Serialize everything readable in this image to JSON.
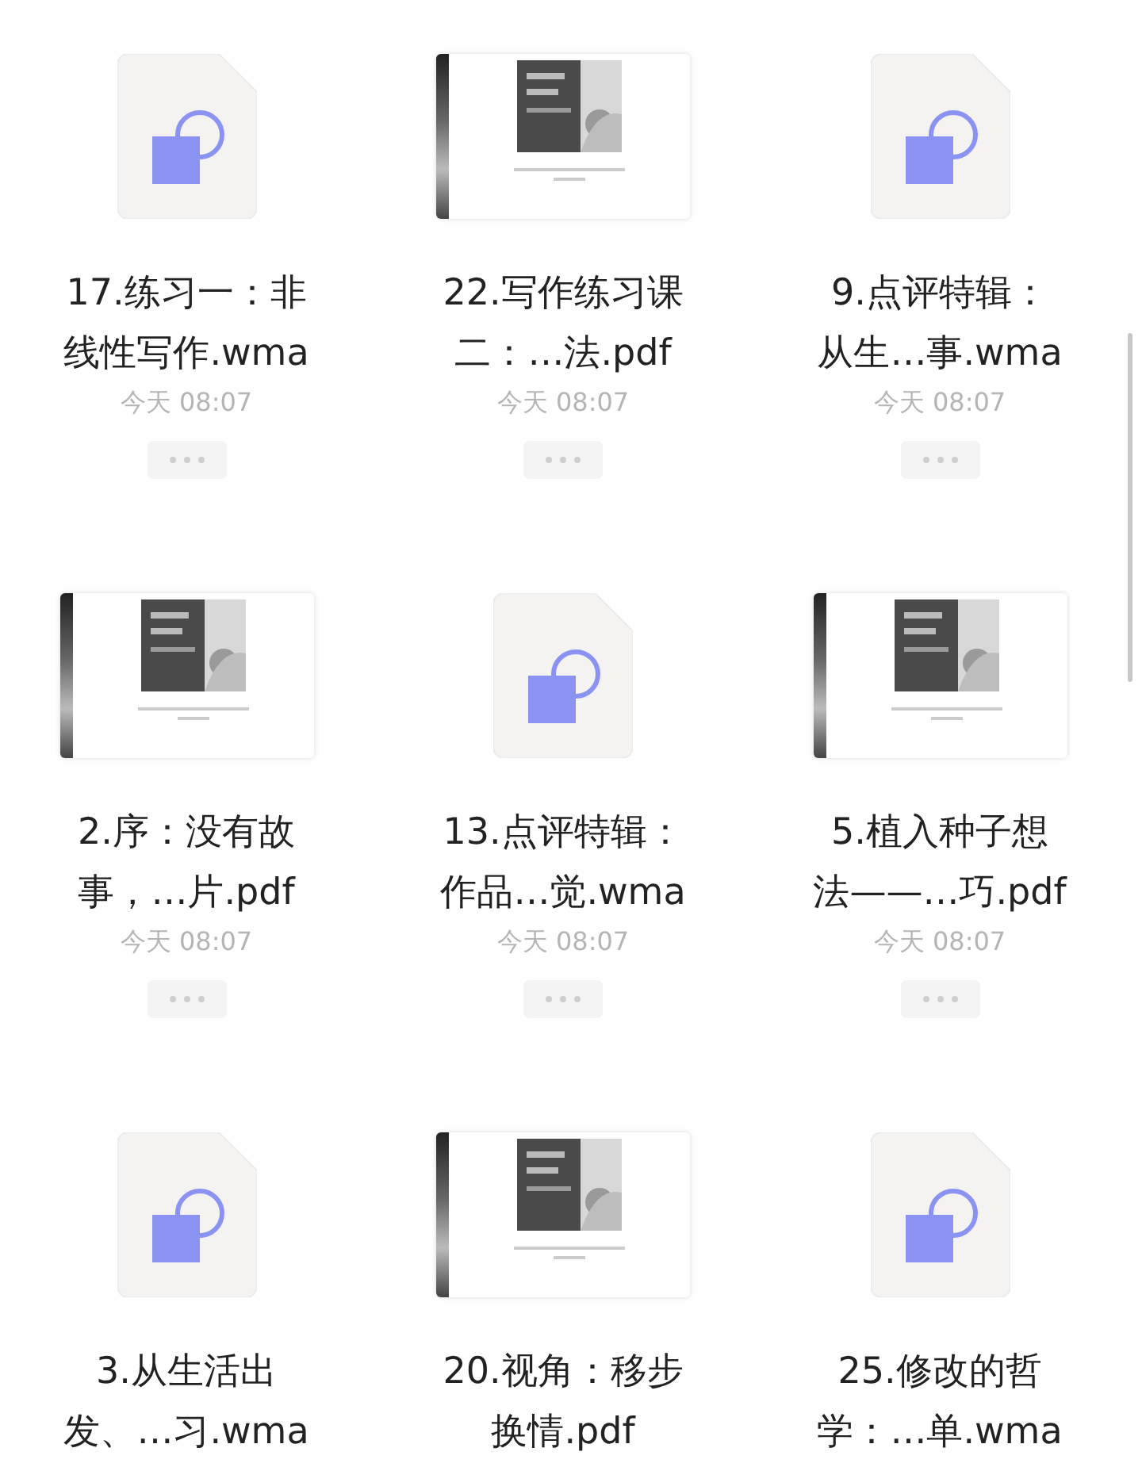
{
  "files": [
    {
      "kind": "audio",
      "name_lines": [
        "17.练习一：非",
        "线性写作.wma"
      ],
      "time": "今天 08:07"
    },
    {
      "kind": "pdf",
      "name_lines": [
        "22.写作练习课",
        "二：…法.pdf"
      ],
      "time": "今天 08:07"
    },
    {
      "kind": "audio",
      "name_lines": [
        "9.点评特辑：",
        "从生…事.wma"
      ],
      "time": "今天 08:07"
    },
    {
      "kind": "pdf",
      "name_lines": [
        "2.序：没有故",
        "事，…片.pdf"
      ],
      "time": "今天 08:07"
    },
    {
      "kind": "audio",
      "name_lines": [
        "13.点评特辑：",
        "作品…觉.wma"
      ],
      "time": "今天 08:07"
    },
    {
      "kind": "pdf",
      "name_lines": [
        "5.植入种子想",
        "法——…巧.pdf"
      ],
      "time": "今天 08:07"
    },
    {
      "kind": "audio",
      "name_lines": [
        "3.从生活出",
        "发、…习.wma"
      ]
    },
    {
      "kind": "pdf",
      "name_lines": [
        "20.视角：移步",
        "换情.pdf"
      ]
    },
    {
      "kind": "audio",
      "name_lines": [
        "25.修改的哲",
        "学：…单.wma"
      ]
    }
  ]
}
